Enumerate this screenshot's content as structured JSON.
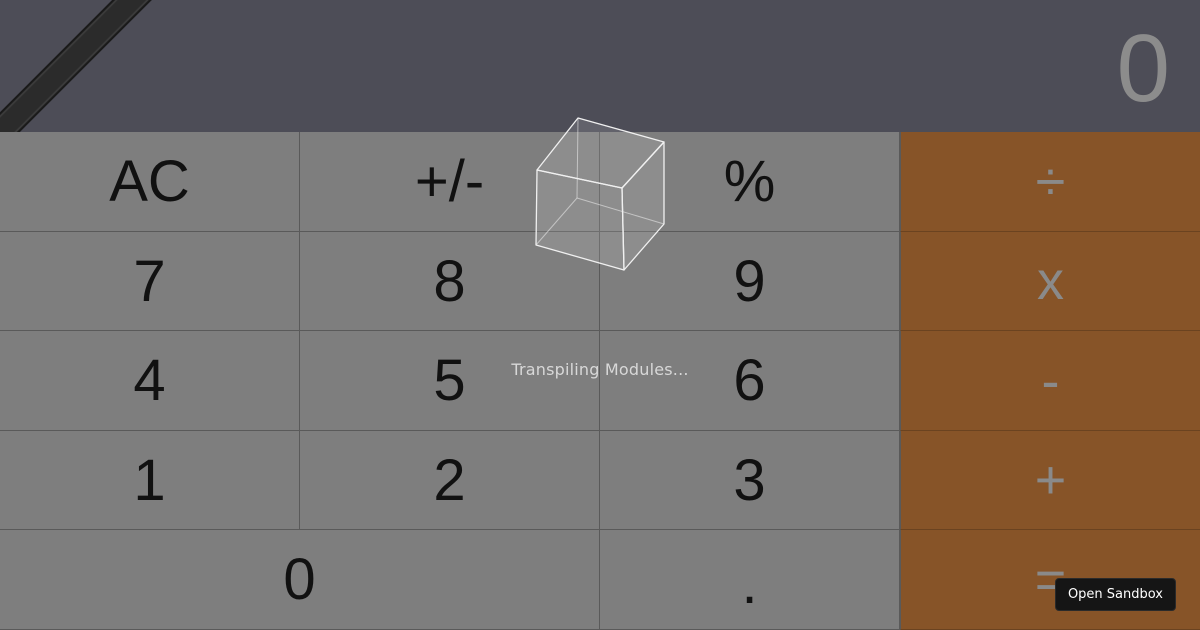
{
  "display": {
    "value": "0"
  },
  "keys": {
    "ac": "AC",
    "sign": "+/-",
    "percent": "%",
    "divide": "÷",
    "seven": "7",
    "eight": "8",
    "nine": "9",
    "multiply": "x",
    "four": "4",
    "five": "5",
    "six": "6",
    "minus": "-",
    "one": "1",
    "two": "2",
    "three": "3",
    "plus": "+",
    "zero": "0",
    "dot": ".",
    "equals": "="
  },
  "overlay": {
    "loading_text": "Transpiling Modules...",
    "loading_icon": "cube-icon"
  },
  "sandbox": {
    "button_label": "Open Sandbox"
  },
  "colors": {
    "display_bg": "#4d4d57",
    "key_bg": "#7e7e7e",
    "operator_bg": "#875428"
  }
}
